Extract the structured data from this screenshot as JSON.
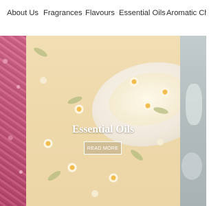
{
  "nav": {
    "items": [
      {
        "label": "About Us"
      },
      {
        "label": "Fragrances"
      },
      {
        "label": "Flavours"
      },
      {
        "label": "Essential Oils"
      },
      {
        "label": "Aromatic Che"
      }
    ]
  },
  "slider": {
    "active_slide": {
      "title": "Essential Oils",
      "button_label": "READ MORE"
    },
    "colors": {
      "prev_slide": "#c85a7e",
      "active_slide": "#ecd39e",
      "next_slide": "#b3bcbd"
    }
  }
}
